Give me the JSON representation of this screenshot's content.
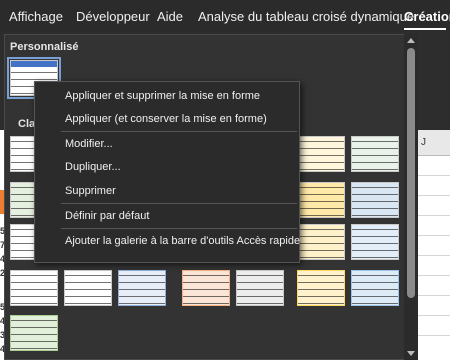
{
  "ribbon": {
    "tabs": [
      {
        "label": "Affichage"
      },
      {
        "label": "Développeur"
      },
      {
        "label": "Aide"
      },
      {
        "label": "Analyse du tableau croisé dynamique"
      },
      {
        "label": "Création"
      }
    ],
    "active_tab": "Création"
  },
  "gallery": {
    "section_custom": "Personnalisé",
    "section_light_partial": "Clai"
  },
  "sheet": {
    "column_header": "J",
    "row_numbers": [
      "5",
      "7",
      "4",
      "2",
      "5",
      "4",
      "3",
      "4"
    ]
  },
  "context_menu": {
    "items": [
      {
        "label": "Appliquer et supprimer la mise en forme"
      },
      {
        "label": "Appliquer (et conserver la mise en forme)"
      },
      {
        "label": "Modifier..."
      },
      {
        "label": "Dupliquer..."
      },
      {
        "label": "Supprimer"
      },
      {
        "label": "Définir par défaut"
      },
      {
        "label": "Ajouter la galerie à la barre d'outils Accès rapide"
      }
    ]
  },
  "colors": {
    "ribbon_bg": "#2b2b2b",
    "gallery_bg": "#333333",
    "menu_bg": "#2b2b2b",
    "accent_orange": "#ed7d31",
    "selected_swatch_header": "#4472c4"
  },
  "style_swatch_palette": [
    "#8fb0df",
    "#d9d9d9",
    "#9dc3e6",
    "#f4b183",
    "#c9c9c9",
    "#ffd966",
    "#a9d08e",
    "#bdd7ee"
  ]
}
